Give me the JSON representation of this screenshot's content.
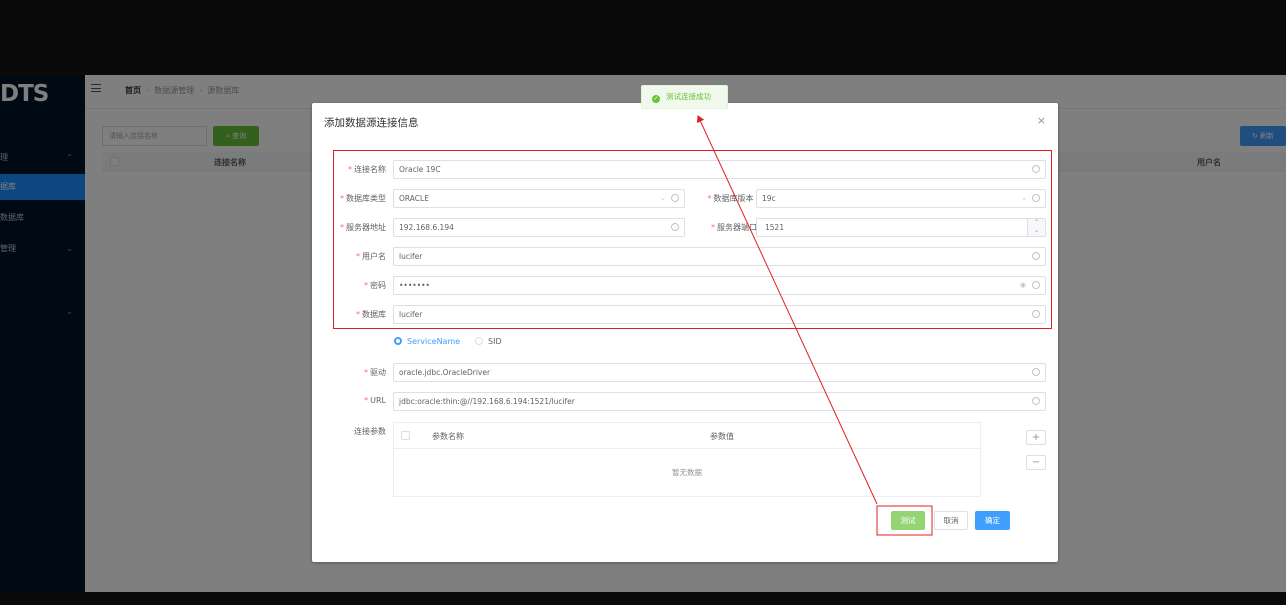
{
  "app": {
    "logo": "DTS",
    "sidebar": {
      "items": [
        {
          "label": "理",
          "chevron": "^"
        },
        {
          "label": "据库"
        },
        {
          "label": "数据库"
        },
        {
          "label": "管理",
          "chevron": "v"
        },
        {
          "label": "",
          "chevron": "v"
        }
      ]
    },
    "breadcrumb": {
      "home": "首页",
      "level1": "数据源管理",
      "level2": "源数据库"
    },
    "search": {
      "placeholder": "请输入连接名称"
    },
    "query_button": "查询",
    "refresh_button": "刷新",
    "table": {
      "columns": [
        "连接名称",
        "用户名"
      ]
    }
  },
  "dialog": {
    "title": "添加数据源连接信息",
    "close": "×",
    "form": {
      "conn_name": {
        "label": "连接名称",
        "value": "Oracle 19C"
      },
      "db_type": {
        "label": "数据库类型",
        "value": "ORACLE"
      },
      "db_version": {
        "label": "数据库版本",
        "value": "19c"
      },
      "host": {
        "label": "服务器地址",
        "value": "192.168.6.194"
      },
      "port": {
        "label": "服务器端口",
        "value": "1521"
      },
      "username": {
        "label": "用户名",
        "value": "lucifer"
      },
      "password": {
        "label": "密码",
        "value": "•••••••"
      },
      "database": {
        "label": "数据库",
        "value": "lucifer"
      },
      "radio": {
        "option1": "ServiceName",
        "option2": "SID",
        "selected": "ServiceName"
      },
      "driver": {
        "label": "驱动",
        "value": "oracle.jdbc.OracleDriver"
      },
      "url": {
        "label": "URL",
        "value": "jdbc:oracle:thin:@//192.168.6.194:1521/lucifer"
      },
      "params": {
        "label": "连接参数",
        "col_name": "参数名称",
        "col_value": "参数值",
        "empty": "暂无数据",
        "add": "+",
        "remove": "−"
      }
    },
    "buttons": {
      "test": "测试",
      "cancel": "取消",
      "ok": "确定"
    }
  },
  "toast": {
    "message": "测试连接成功"
  },
  "colors": {
    "primary": "#409eff",
    "success": "#67c23a",
    "annotation": "#e02020",
    "sidebar": "#001529"
  }
}
